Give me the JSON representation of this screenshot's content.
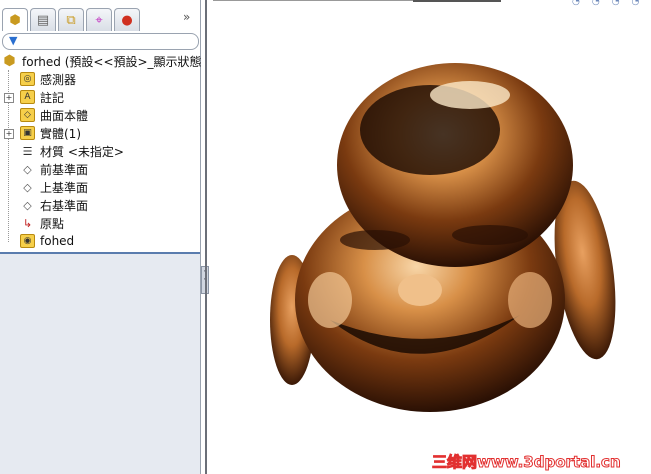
{
  "panel": {
    "tabs": [
      "feature-manager",
      "property-manager",
      "configuration-manager",
      "dimxpert-manager",
      "display-manager"
    ],
    "more": "»",
    "filter_icon": "▼",
    "tree": [
      {
        "label": "forhed (預設<<預設>_顯示狀態",
        "icon": "part-icon"
      },
      {
        "label": "感測器",
        "icon": "sensor-folder-icon",
        "glyph": "◎"
      },
      {
        "label": "註記",
        "icon": "annotation-folder-icon",
        "glyph": "A",
        "expandable": true
      },
      {
        "label": "曲面本體",
        "icon": "surface-bodies-icon",
        "glyph": "◇"
      },
      {
        "label": "實體(1)",
        "icon": "solid-bodies-icon",
        "glyph": "▣",
        "expandable": true
      },
      {
        "label": "材質 <未指定>",
        "icon": "material-icon",
        "glyph": "☰"
      },
      {
        "label": "前基準面",
        "icon": "plane-icon",
        "glyph": "◇"
      },
      {
        "label": "上基準面",
        "icon": "plane-icon",
        "glyph": "◇"
      },
      {
        "label": "右基準面",
        "icon": "plane-icon",
        "glyph": "◇"
      },
      {
        "label": "原點",
        "icon": "origin-icon",
        "glyph": "↳"
      },
      {
        "label": "fohed",
        "icon": "imported-feature-icon",
        "glyph": "◉"
      }
    ]
  },
  "watermark": "三维网www.3dportal.cn"
}
